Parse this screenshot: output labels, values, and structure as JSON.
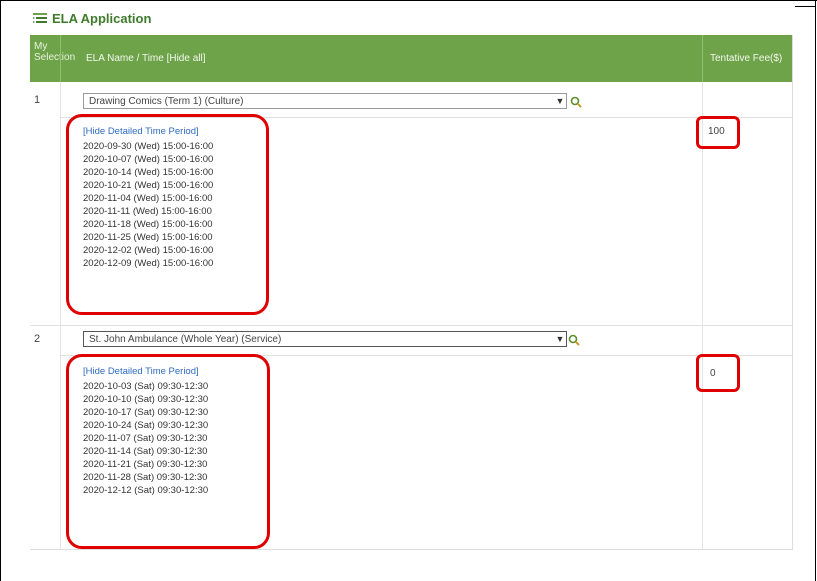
{
  "title": "ELA Application",
  "table": {
    "col_selection": "My Selection",
    "col_name": "ELA Name / Time [Hide all]",
    "col_fee": "Tentative Fee($)"
  },
  "rows": [
    {
      "number": "1",
      "selected": "Drawing Comics (Term 1) (Culture)",
      "hide_link": "[Hide Detailed Time Period]",
      "dates": [
        "2020-09-30 (Wed) 15:00-16:00",
        "2020-10-07 (Wed) 15:00-16:00",
        "2020-10-14 (Wed) 15:00-16:00",
        "2020-10-21 (Wed) 15:00-16:00",
        "2020-11-04 (Wed) 15:00-16:00",
        "2020-11-11 (Wed) 15:00-16:00",
        "2020-11-18 (Wed) 15:00-16:00",
        "2020-11-25 (Wed) 15:00-16:00",
        "2020-12-02 (Wed) 15:00-16:00",
        "2020-12-09 (Wed) 15:00-16:00"
      ],
      "fee": "100"
    },
    {
      "number": "2",
      "selected": "St. John Ambulance (Whole Year) (Service)",
      "hide_link": "[Hide Detailed Time Period]",
      "dates": [
        "2020-10-03 (Sat) 09:30-12:30",
        "2020-10-10 (Sat) 09:30-12:30",
        "2020-10-17 (Sat) 09:30-12:30",
        "2020-10-24 (Sat) 09:30-12:30",
        "2020-11-07 (Sat) 09:30-12:30",
        "2020-11-14 (Sat) 09:30-12:30",
        "2020-11-21 (Sat) 09:30-12:30",
        "2020-11-28 (Sat) 09:30-12:30",
        "2020-12-12 (Sat) 09:30-12:30"
      ],
      "fee": "0"
    }
  ],
  "colors": {
    "header_green": "#6ea34a",
    "title_green": "#3e7b2a",
    "highlight_red": "#e00000",
    "link_blue": "#2f6bbf"
  },
  "icons": {
    "title": "list-application-icon",
    "search": "magnifier-icon",
    "dropdown": "chevron-down-icon"
  }
}
